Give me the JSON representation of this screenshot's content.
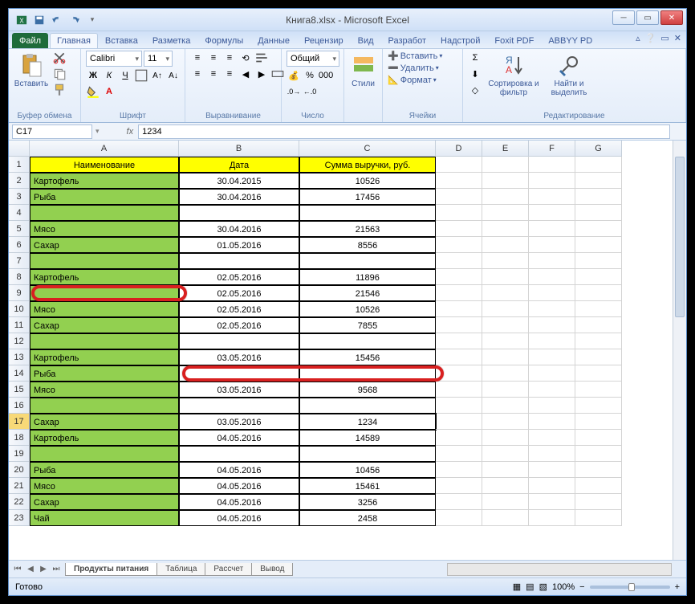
{
  "window": {
    "title": "Книга8.xlsx - Microsoft Excel"
  },
  "tabs": {
    "file": "Файл",
    "list": [
      "Главная",
      "Вставка",
      "Разметка",
      "Формулы",
      "Данные",
      "Рецензир",
      "Вид",
      "Разработ",
      "Надстрой",
      "Foxit PDF",
      "ABBYY PD"
    ],
    "active_index": 0
  },
  "ribbon": {
    "clipboard": {
      "paste": "Вставить",
      "label": "Буфер обмена"
    },
    "font": {
      "name": "Calibri",
      "size": "11",
      "label": "Шрифт"
    },
    "align": {
      "general": "Общий",
      "label_align": "Выравнивание",
      "label_number": "Число"
    },
    "styles": {
      "btn": "Стили",
      "label": ""
    },
    "cells": {
      "insert": "Вставить",
      "delete": "Удалить",
      "format": "Формат",
      "label": "Ячейки"
    },
    "editing": {
      "sort": "Сортировка и фильтр",
      "find": "Найти и выделить",
      "label": "Редактирование"
    }
  },
  "formula_bar": {
    "name_box": "C17",
    "fx": "fx",
    "value": "1234"
  },
  "columns": [
    "A",
    "B",
    "C",
    "D",
    "E",
    "F",
    "G"
  ],
  "headers": {
    "a": "Наименование",
    "b": "Дата",
    "c": "Сумма выручки, руб."
  },
  "rows": [
    {
      "n": 2,
      "a": "Картофель",
      "b": "30.04.2015",
      "c": "10526"
    },
    {
      "n": 3,
      "a": "Рыба",
      "b": "30.04.2016",
      "c": "17456"
    },
    {
      "n": 4,
      "a": "",
      "b": "",
      "c": ""
    },
    {
      "n": 5,
      "a": "Мясо",
      "b": "30.04.2016",
      "c": "21563"
    },
    {
      "n": 6,
      "a": "Сахар",
      "b": "01.05.2016",
      "c": "8556"
    },
    {
      "n": 7,
      "a": "",
      "b": "",
      "c": ""
    },
    {
      "n": 8,
      "a": "Картофель",
      "b": "02.05.2016",
      "c": "11896"
    },
    {
      "n": 9,
      "a": "",
      "b": "02.05.2016",
      "c": "21546"
    },
    {
      "n": 10,
      "a": "Мясо",
      "b": "02.05.2016",
      "c": "10526"
    },
    {
      "n": 11,
      "a": "Сахар",
      "b": "02.05.2016",
      "c": "7855"
    },
    {
      "n": 12,
      "a": "",
      "b": "",
      "c": ""
    },
    {
      "n": 13,
      "a": "Картофель",
      "b": "03.05.2016",
      "c": "15456"
    },
    {
      "n": 14,
      "a": "Рыба",
      "b": "",
      "c": ""
    },
    {
      "n": 15,
      "a": "Мясо",
      "b": "03.05.2016",
      "c": "9568"
    },
    {
      "n": 16,
      "a": "",
      "b": "",
      "c": ""
    },
    {
      "n": 17,
      "a": "Сахар",
      "b": "03.05.2016",
      "c": "1234"
    },
    {
      "n": 18,
      "a": "Картофель",
      "b": "04.05.2016",
      "c": "14589"
    },
    {
      "n": 19,
      "a": "",
      "b": "",
      "c": ""
    },
    {
      "n": 20,
      "a": "Рыба",
      "b": "04.05.2016",
      "c": "10456"
    },
    {
      "n": 21,
      "a": "Мясо",
      "b": "04.05.2016",
      "c": "15461"
    },
    {
      "n": 22,
      "a": "Сахар",
      "b": "04.05.2016",
      "c": "3256"
    },
    {
      "n": 23,
      "a": "Чай",
      "b": "04.05.2016",
      "c": "2458"
    }
  ],
  "active_row": 17,
  "sheet_tabs": {
    "list": [
      "Продукты питания",
      "Таблица",
      "Рассчет",
      "Вывод"
    ],
    "active_index": 0
  },
  "status": {
    "ready": "Готово",
    "zoom": "100%"
  }
}
